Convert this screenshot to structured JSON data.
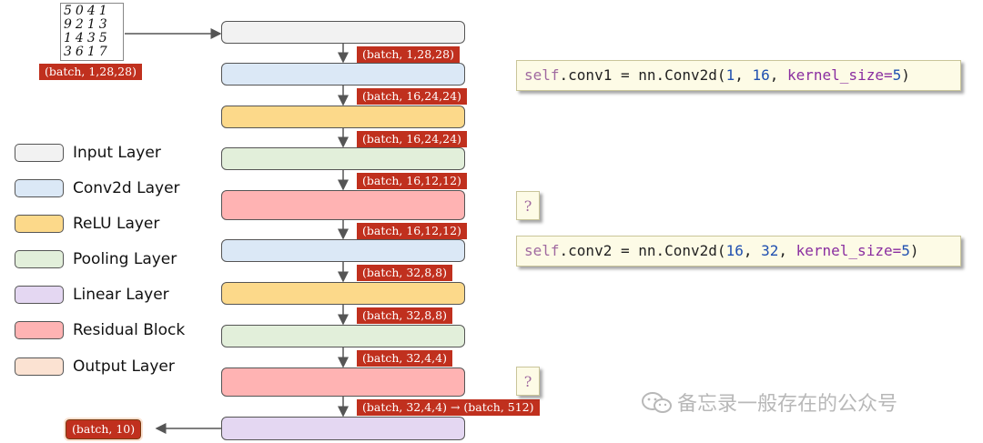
{
  "input_image": {
    "digit_rows": [
      "5041",
      "9213",
      "1435",
      "3617"
    ],
    "shape": "(batch, 1,28,28)"
  },
  "shapes": [
    "(batch, 1,28,28)",
    "(batch, 16,24,24)",
    "(batch, 16,24,24)",
    "(batch, 16,12,12)",
    "(batch, 16,12,12)",
    "(batch, 32,8,8)",
    "(batch, 32,8,8)",
    "(batch, 32,4,4)",
    "(batch, 32,4,4) → (batch, 512)"
  ],
  "output_shape": "(batch, 10)",
  "legend": [
    {
      "label": "Input Layer",
      "color": "#f2f2f2"
    },
    {
      "label": "Conv2d Layer",
      "color": "#dbe8f6"
    },
    {
      "label": "ReLU Layer",
      "color": "#fcd98a"
    },
    {
      "label": "Pooling Layer",
      "color": "#e2efda"
    },
    {
      "label": "Linear Layer",
      "color": "#e4d7f2"
    },
    {
      "label": "Residual Block",
      "color": "#ffb3b3"
    },
    {
      "label": "Output Layer",
      "color": "#fbe2d2"
    }
  ],
  "code": {
    "conv1": {
      "self": "self",
      "rest1": ".conv1 = nn.Conv2d(",
      "arg1": "1",
      "sep": ", ",
      "arg2": "16",
      "kw": "kernel_size",
      "eq": "=",
      "arg3": "5",
      "close": ")"
    },
    "conv2": {
      "self": "self",
      "rest1": ".conv2 = nn.Conv2d(",
      "arg1": "16",
      "sep": ", ",
      "arg2": "32",
      "kw": "kernel_size",
      "eq": "=",
      "arg3": "5",
      "close": ")"
    },
    "question_mark": "?"
  },
  "watermark": "备忘录一般存在的公众号",
  "colors": {
    "shape_label_bg": "#c0301e",
    "code_bg": "#fdfbe6"
  }
}
